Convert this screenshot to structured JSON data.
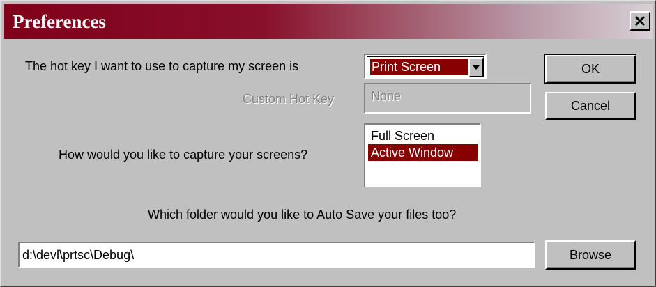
{
  "window": {
    "title": "Preferences"
  },
  "hotkey": {
    "label": "The hot key I want to use to capture my screen is",
    "selected": "Print Screen"
  },
  "custom_hotkey": {
    "label": "Custom Hot Key",
    "value": "None"
  },
  "capture": {
    "label": "How would you like to capture your screens?",
    "options": [
      "Full Screen",
      "Active Window"
    ],
    "selected": "Active Window"
  },
  "autosave": {
    "label": "Which folder would you like to Auto Save your files too?",
    "path": "d:\\devl\\prtsc\\Debug\\"
  },
  "buttons": {
    "ok": "OK",
    "cancel": "Cancel",
    "browse": "Browse"
  },
  "colors": {
    "title_bar": "#80001a",
    "selection": "#880000",
    "face": "#c0c0c0"
  },
  "icons": {
    "close": "close-icon",
    "dropdown": "dropdown-arrow-icon"
  }
}
